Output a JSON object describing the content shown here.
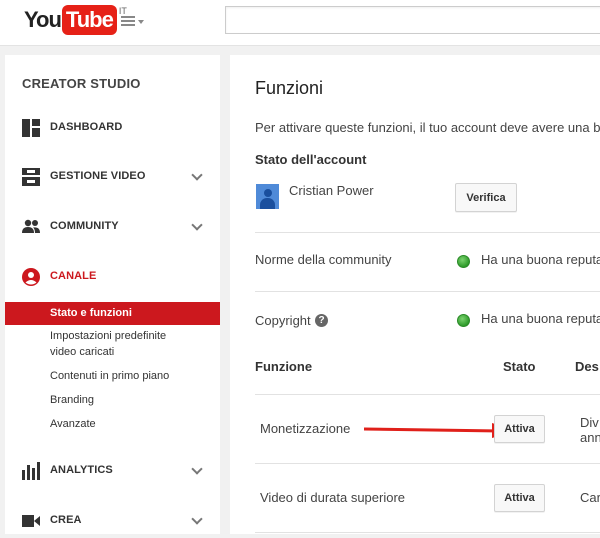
{
  "header": {
    "logo_you": "You",
    "logo_tube": "Tube",
    "logo_country": "IT",
    "search": {
      "value": "",
      "placeholder": ""
    }
  },
  "sidebar": {
    "title": "CREATOR STUDIO",
    "items": [
      {
        "label": "DASHBOARD",
        "icon": "dashboard-icon"
      },
      {
        "label": "GESTIONE VIDEO",
        "icon": "video-manager-icon"
      },
      {
        "label": "COMMUNITY",
        "icon": "community-icon"
      },
      {
        "label": "CANALE",
        "icon": "channel-icon"
      },
      {
        "label": "ANALYTICS",
        "icon": "analytics-icon"
      },
      {
        "label": "CREA",
        "icon": "create-icon"
      }
    ],
    "channel_sub": [
      "Stato e funzioni",
      "Impostazioni predefinite",
      "video caricati",
      "Contenuti in primo piano",
      "Branding",
      "Avanzate"
    ]
  },
  "main": {
    "title": "Funzioni",
    "intro": "Per attivare queste funzioni, il tuo account deve avere una bu",
    "account_heading": "Stato dell'account",
    "user_name": "Cristian Power",
    "verify_label": "Verifica",
    "community_label": "Norme della community",
    "community_status": "Ha una buona reputa",
    "copyright_label": "Copyright",
    "copyright_help": "?",
    "copyright_status": "Ha una buona reputa",
    "columns": {
      "feature": "Funzione",
      "state": "Stato",
      "desc": "Des"
    },
    "features": [
      {
        "name": "Monetizzazione",
        "button": "Attiva",
        "desc1": "Div",
        "desc2": "ann"
      },
      {
        "name": "Video di durata superiore",
        "button": "Attiva",
        "desc1": "Car"
      }
    ]
  },
  "colors": {
    "brand_red": "#e62117",
    "active_red": "#cc181e",
    "status_green": "#2f9b2b",
    "arrow_red": "#e0201a"
  }
}
